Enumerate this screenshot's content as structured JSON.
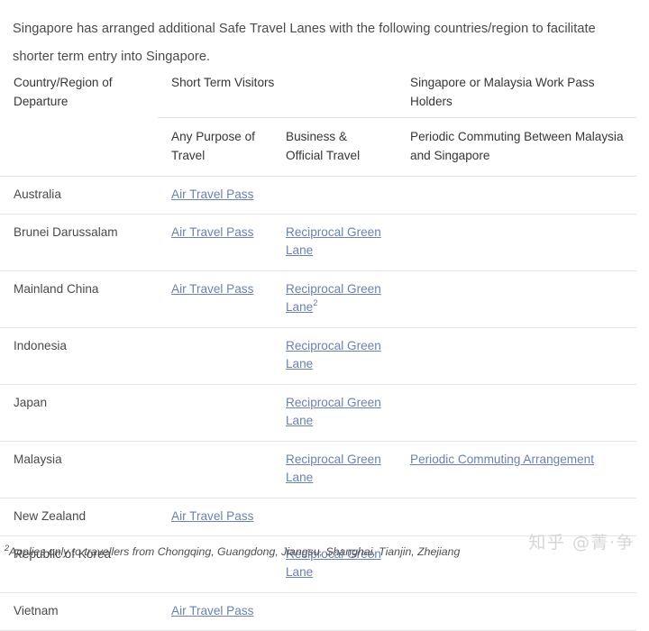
{
  "intro": {
    "text": "Singapore has arranged additional Safe Travel Lanes with the following countries/region to facilitate shorter term entry into Singapore."
  },
  "table": {
    "header_groups": {
      "country": "Country/Region of Departure",
      "short_term_visitors": "Short Term Visitors",
      "work_pass_holders": "Singapore or Malaysia Work Pass Holders"
    },
    "header_sub": {
      "any_purpose": "Any Purpose of Travel",
      "business_official": "Business & Official Travel",
      "periodic_commuting": "Periodic Commuting Between Malaysia and Singapore"
    },
    "link_labels": {
      "air_travel_pass": "Air Travel Pass",
      "reciprocal_green_lane": "Reciprocal Green Lane",
      "periodic_commuting_arrangement": "Periodic Commuting Arrangement",
      "footnote_marker": "2"
    },
    "rows": [
      {
        "country": "Australia",
        "any_purpose": "Air Travel Pass",
        "business_official": "",
        "periodic_commuting": "",
        "footnote": false
      },
      {
        "country": "Brunei Darussalam",
        "any_purpose": "Air Travel Pass",
        "business_official": "Reciprocal Green Lane",
        "periodic_commuting": "",
        "footnote": false
      },
      {
        "country": "Mainland China",
        "any_purpose": "Air Travel Pass",
        "business_official": "Reciprocal Green Lane",
        "periodic_commuting": "",
        "footnote": true
      },
      {
        "country": "Indonesia",
        "any_purpose": "",
        "business_official": "Reciprocal Green Lane",
        "periodic_commuting": "",
        "footnote": false
      },
      {
        "country": "Japan",
        "any_purpose": "",
        "business_official": "Reciprocal Green Lane",
        "periodic_commuting": "",
        "footnote": false
      },
      {
        "country": "Malaysia",
        "any_purpose": "",
        "business_official": "Reciprocal Green Lane",
        "periodic_commuting": "Periodic Commuting Arrangement",
        "footnote": false
      },
      {
        "country": "New Zealand",
        "any_purpose": "Air Travel Pass",
        "business_official": "",
        "periodic_commuting": "",
        "footnote": false
      },
      {
        "country": "Republic of Korea",
        "any_purpose": "",
        "business_official": "Reciprocal Green Lane",
        "periodic_commuting": "",
        "footnote": false
      },
      {
        "country": "Vietnam",
        "any_purpose": "Air Travel Pass",
        "business_official": "",
        "periodic_commuting": "",
        "footnote": false
      }
    ]
  },
  "footnote": {
    "marker": "2",
    "text": "Applies only to travellers from Chongqing, Guangdong, Jiangsu, Shanghai, Tianjin, Zhejiang"
  },
  "watermark": {
    "text": "知乎 @菁·争"
  },
  "colors": {
    "link": "#6b82ad",
    "body_text": "#4a4a4a",
    "header_text": "#363636",
    "rule": "#e6e6e6",
    "watermark": "#d6d6d6"
  }
}
